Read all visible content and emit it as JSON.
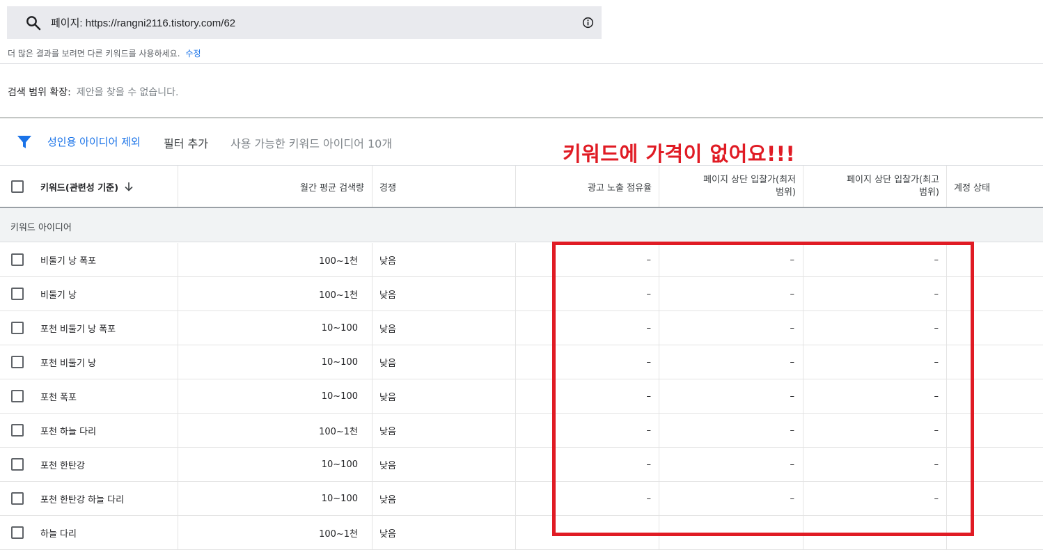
{
  "search": {
    "text": "페이지: https://rangni2116.tistory.com/62",
    "hint": "더 많은 결과를 보려면 다른 키워드를 사용하세요.",
    "hint_link": "수정"
  },
  "expand": {
    "label": "검색 범위 확장:",
    "value": "제안을 찾을 수 없습니다."
  },
  "filter": {
    "exclude_adult": "성인용 아이디어 제외",
    "add_filter": "필터 추가",
    "count_text": "사용 가능한 키워드 아이디어 10개"
  },
  "annotation": "키워드에 가격이 없어요!!!",
  "columns": {
    "keyword": "키워드(관련성 기준)",
    "monthly": "월간 평균 검색량",
    "competition": "경쟁",
    "impression_share": "광고 노출 점유율",
    "bid_low_1": "페이지 상단 입찰가(최저",
    "bid_low_2": "범위)",
    "bid_high_1": "페이지 상단 입찰가(최고",
    "bid_high_2": "범위)",
    "account_status": "계정 상태"
  },
  "group_label": "키워드 아이디어",
  "rows": [
    {
      "keyword": "비둘기 낭 폭포",
      "monthly": "100~1천",
      "competition": "낮음",
      "impression": "–",
      "bid_low": "–",
      "bid_high": "–"
    },
    {
      "keyword": "비둘기 낭",
      "monthly": "100~1천",
      "competition": "낮음",
      "impression": "–",
      "bid_low": "–",
      "bid_high": "–"
    },
    {
      "keyword": "포천 비둘기 낭 폭포",
      "monthly": "10~100",
      "competition": "낮음",
      "impression": "–",
      "bid_low": "–",
      "bid_high": "–"
    },
    {
      "keyword": "포천 비둘기 낭",
      "monthly": "10~100",
      "competition": "낮음",
      "impression": "–",
      "bid_low": "–",
      "bid_high": "–"
    },
    {
      "keyword": "포천 폭포",
      "monthly": "10~100",
      "competition": "낮음",
      "impression": "–",
      "bid_low": "–",
      "bid_high": "–"
    },
    {
      "keyword": "포천 하늘 다리",
      "monthly": "100~1천",
      "competition": "낮음",
      "impression": "–",
      "bid_low": "–",
      "bid_high": "–"
    },
    {
      "keyword": "포천 한탄강",
      "monthly": "10~100",
      "competition": "낮음",
      "impression": "–",
      "bid_low": "–",
      "bid_high": "–"
    },
    {
      "keyword": "포천 한탄강 하늘 다리",
      "monthly": "10~100",
      "competition": "낮음",
      "impression": "–",
      "bid_low": "–",
      "bid_high": "–"
    },
    {
      "keyword": "하늘 다리",
      "monthly": "100~1천",
      "competition": "낮음",
      "impression": "",
      "bid_low": "",
      "bid_high": ""
    }
  ],
  "colors": {
    "accent": "#1a73e8",
    "annotation_red": "#e01b24",
    "search_bg": "#e9eaee"
  }
}
